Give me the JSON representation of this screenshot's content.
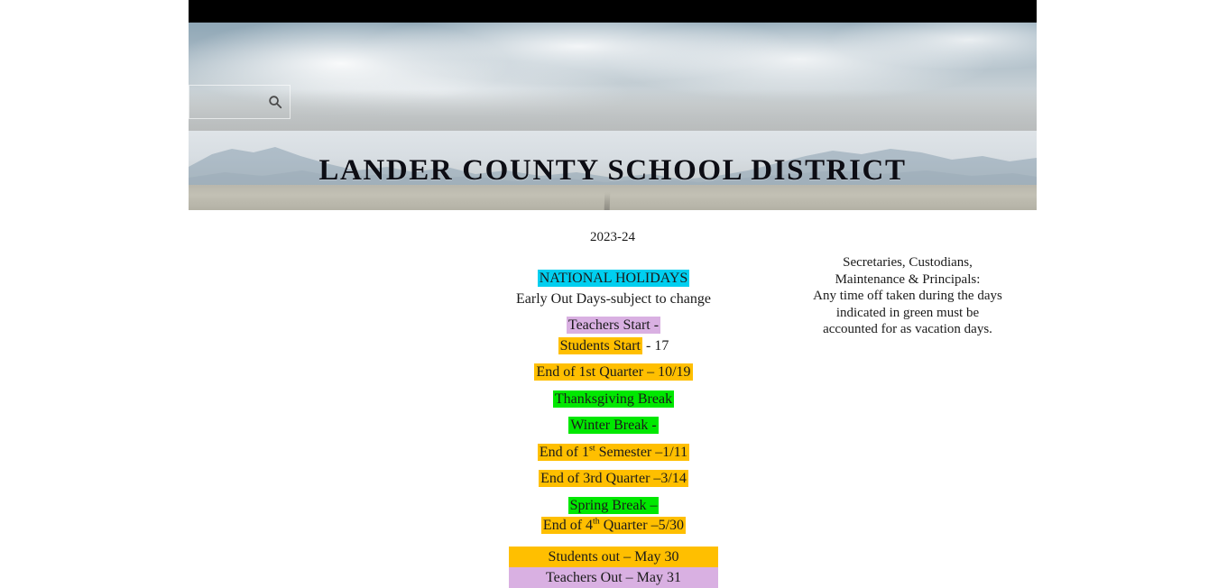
{
  "site": {
    "title": "LANDER COUNTY SCHOOL DISTRICT"
  },
  "search": {
    "value": "",
    "placeholder": "",
    "icon": "search-icon"
  },
  "calendar": {
    "year": "2023-24",
    "rows": [
      {
        "id": "national-holidays",
        "text": "NATIONAL HOLIDAYS",
        "highlight": "cyan"
      },
      {
        "id": "early-out-days",
        "text": "Early Out Days-subject to change",
        "highlight": "none"
      },
      {
        "id": "teachers-start",
        "text": "Teachers Start -",
        "highlight": "lavender"
      },
      {
        "id": "students-start",
        "text": "Students Start",
        "suffix": " - 17",
        "highlight": "orange"
      },
      {
        "id": "end-1st-quarter",
        "text": "End of 1st Quarter – 10/19",
        "highlight": "orange"
      },
      {
        "id": "thanksgiving-break",
        "text": "Thanksgiving Break",
        "highlight": "green"
      },
      {
        "id": "winter-break",
        "text": "Winter Break -",
        "highlight": "green"
      },
      {
        "id": "end-1st-semester",
        "text": "End of 1st Semester –1/11",
        "highlight": "orange",
        "superscript": "st"
      },
      {
        "id": "end-3rd-quarter",
        "text": "End of 3rd Quarter –3/14",
        "highlight": "orange"
      },
      {
        "id": "spring-break",
        "text": "Spring Break –",
        "highlight": "green"
      },
      {
        "id": "end-4th-quarter",
        "text": "End of 4th Quarter –5/30",
        "highlight": "orange",
        "superscript": "th"
      },
      {
        "id": "students-out",
        "text": "Students out – May 30",
        "highlight": "orange-bar"
      },
      {
        "id": "teachers-out",
        "text": "Teachers Out – May 31",
        "highlight": "lavender-bar"
      }
    ],
    "row_parts": {
      "end_1st_semester": {
        "pre": "End of 1",
        "sup": "st",
        "post": " Semester –1/11"
      },
      "end_4th_quarter": {
        "pre": "End of 4",
        "sup": "th",
        "post": " Quarter –5/30"
      }
    }
  },
  "note": {
    "lines": [
      "Secretaries, Custodians,",
      "Maintenance & Principals:",
      "Any time off taken during the days",
      "indicated in green must be",
      "accounted for as vacation days."
    ]
  },
  "colors": {
    "cyan": "#00CFF0",
    "lavender": "#D9B0E2",
    "orange": "#FFBF00",
    "green": "#00E800",
    "topbar": "#000000"
  }
}
